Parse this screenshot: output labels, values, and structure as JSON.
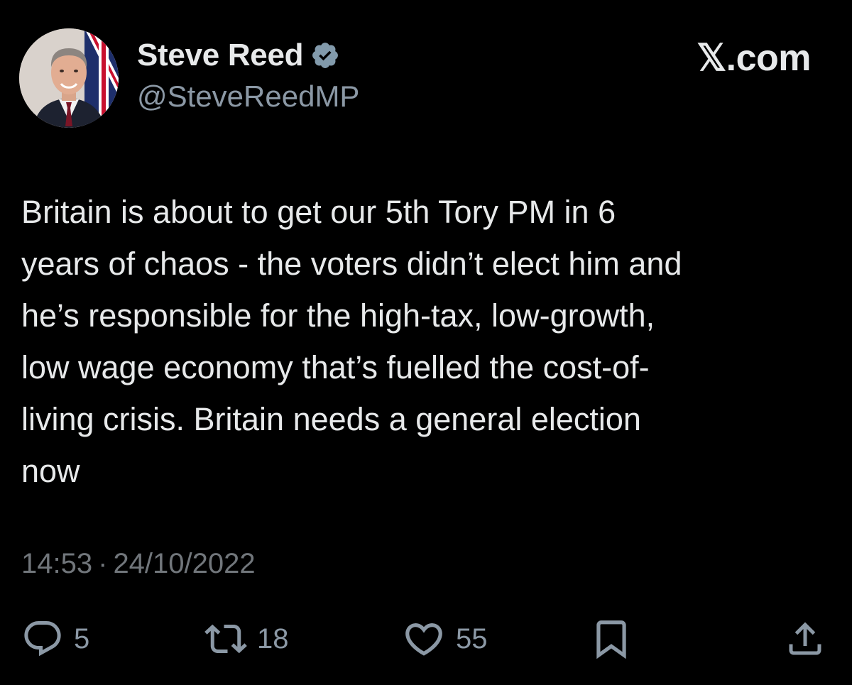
{
  "author": {
    "display_name": "Steve Reed",
    "handle": "@SteveReedMP",
    "verified": true
  },
  "brand": {
    "label": "𝕏.com"
  },
  "tweet": {
    "lines": [
      "Britain is about to get our 5th Tory PM in 6",
      "years of chaos - the voters didn’t elect him and",
      "he’s responsible for the high-tax, low-growth,",
      "low wage economy that’s fuelled the cost-of-",
      "living crisis. Britain needs a general election",
      "now"
    ],
    "time": "14:53",
    "separator": "·",
    "date": "24/10/2022"
  },
  "actions": {
    "replies": "5",
    "reposts": "18",
    "likes": "55"
  },
  "colors": {
    "background": "#000000",
    "text": "#e7e9ea",
    "secondary": "#8b98a5",
    "verified_badge": "#829aab"
  },
  "icons": [
    "verified-badge-icon",
    "reply-icon",
    "repost-icon",
    "like-icon",
    "bookmark-icon",
    "share-icon"
  ]
}
